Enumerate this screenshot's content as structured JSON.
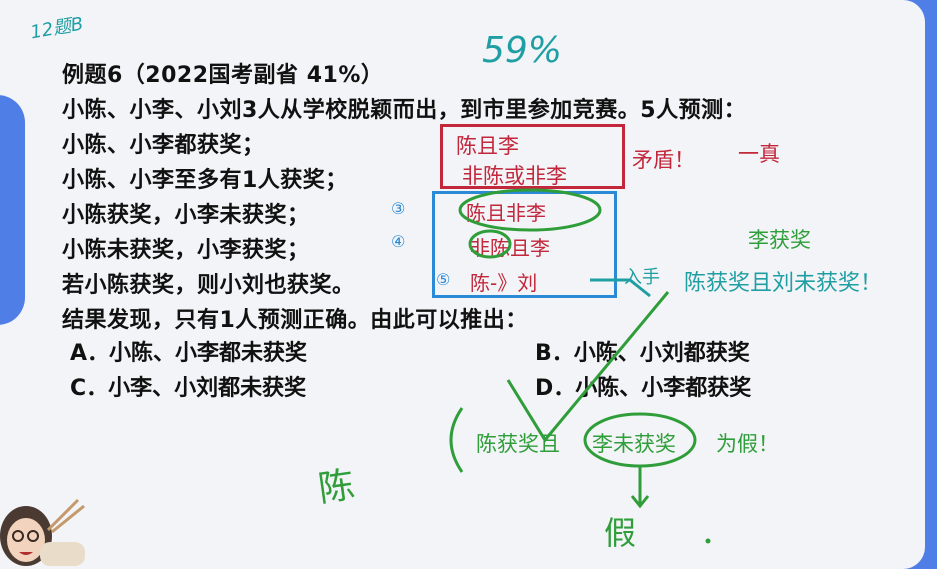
{
  "question": {
    "title": "例题6（2022国考副省 41%）",
    "stem": "小陈、小李、小刘3人从学校脱颖而出，到市里参加竞赛。5人预测：",
    "predictions": [
      "小陈、小李都获奖；",
      "小陈、小李至多有1人获奖；",
      "小陈获奖，小李未获奖；",
      "小陈未获奖，小李获奖；",
      "若小陈获奖，则小刘也获奖。"
    ],
    "result": "结果发现，只有1人预测正确。由此可以推出：",
    "options": [
      "A．小陈、小李都未获奖",
      "B．小陈、小刘都获奖",
      "C．小李、小刘都未获奖",
      "D．小陈、小李都获奖"
    ]
  },
  "annotations": {
    "top_left": "12题B",
    "top_percent": "59%",
    "red_box": [
      "陈且李",
      "非陈或非李"
    ],
    "contradiction": "矛盾！",
    "one_true": "一真",
    "marks": [
      "③",
      "④",
      "⑤"
    ],
    "blue_box": [
      "陈且非李",
      "非陈且李",
      "陈-》刘"
    ],
    "li_award": "李获奖",
    "entry": "入手",
    "chen_award": "陈获奖且刘未获奖！",
    "false_statement_prefix": "陈获奖且",
    "false_statement_circled": "李未获奖",
    "false_statement_suffix": "为假！",
    "chen_char": "陈",
    "jia_char": "假"
  },
  "colors": {
    "background": "#4f7ee6",
    "slide": "#f3f4f7",
    "red": "#c2273c",
    "green": "#2f9e3a",
    "teal": "#1f9fa3",
    "blue": "#2a8ad6"
  }
}
